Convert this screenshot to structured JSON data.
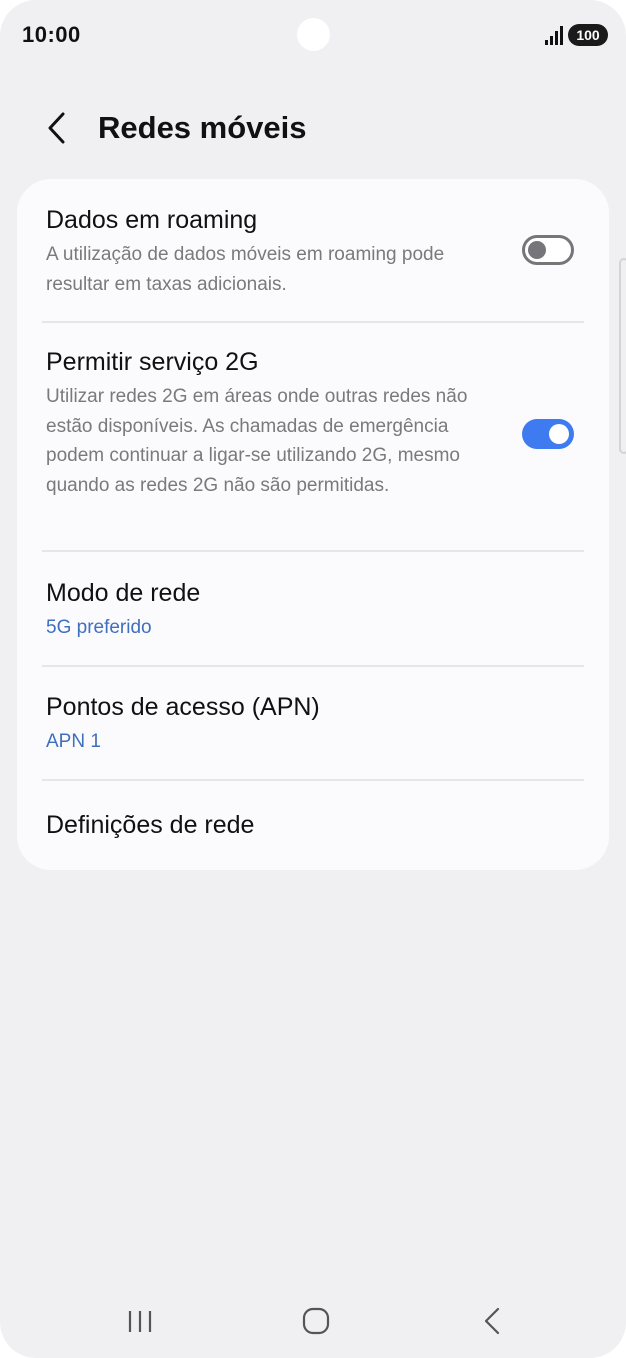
{
  "status_bar": {
    "time": "10:00",
    "battery": "100"
  },
  "header": {
    "title": "Redes móveis"
  },
  "settings": {
    "roaming": {
      "title": "Dados em roaming",
      "description": "A utilização de dados móveis em roaming pode resultar em taxas adicionais.",
      "enabled": false
    },
    "service_2g": {
      "title": "Permitir serviço 2G",
      "description": "Utilizar redes 2G em áreas onde outras redes não estão disponíveis. As chamadas de emergência podem continuar a ligar-se utilizando 2G, mesmo quando as redes 2G não são permitidas.",
      "enabled": true
    },
    "network_mode": {
      "title": "Modo de rede",
      "value": "5G preferido"
    },
    "apn": {
      "title": "Pontos de acesso (APN)",
      "value": "APN 1"
    },
    "network_settings": {
      "title": "Definições de rede"
    }
  },
  "colors": {
    "accent": "#3e7bf0",
    "link": "#3f6fbd",
    "background": "#f0f0f3",
    "card": "#fbfbfd"
  },
  "icons": {
    "back": "chevron-left-icon",
    "signal": "signal-icon",
    "nav_recents": "recents-icon",
    "nav_home": "home-icon",
    "nav_back": "back-icon"
  }
}
